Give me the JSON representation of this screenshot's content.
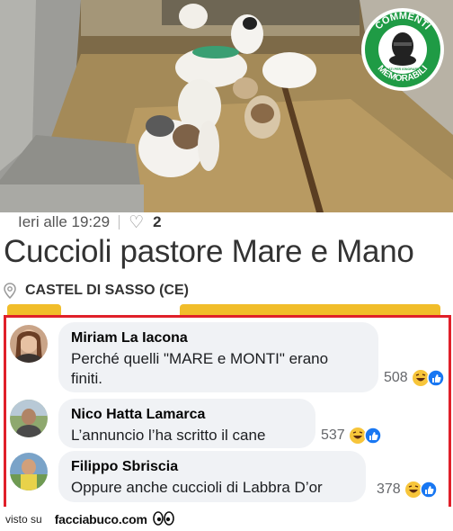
{
  "listing": {
    "time": "Ieri alle 19:29",
    "likes": "2",
    "title": "Cuccioli pastore Mare e Mano",
    "location": "CASTEL DI SASSO (CE)"
  },
  "badge": {
    "line1": "COMMENTI",
    "line2": "MEMORABILI",
    "tag": "NATI PER IGNORARE"
  },
  "comments": [
    {
      "name": "Miriam La Iacona",
      "lines": [
        "Perché quelli \"MARE e MONTI\" erano",
        "finiti."
      ],
      "count": "508"
    },
    {
      "name": "Nico Hatta Lamarca",
      "lines": [
        "L’annuncio l’ha scritto il cane"
      ],
      "count": "537"
    },
    {
      "name": "Filippo Sbriscia",
      "lines": [
        "Oppure anche cuccioli di Labbra D’or"
      ],
      "count": "378"
    }
  ],
  "footer": {
    "visto": "visto su",
    "brand": "facciabuco.com"
  },
  "colors": {
    "frame": "#e0202a",
    "bubble": "#f0f2f5",
    "badge": "#1f9b45",
    "yellow": "#f1bd2a"
  }
}
